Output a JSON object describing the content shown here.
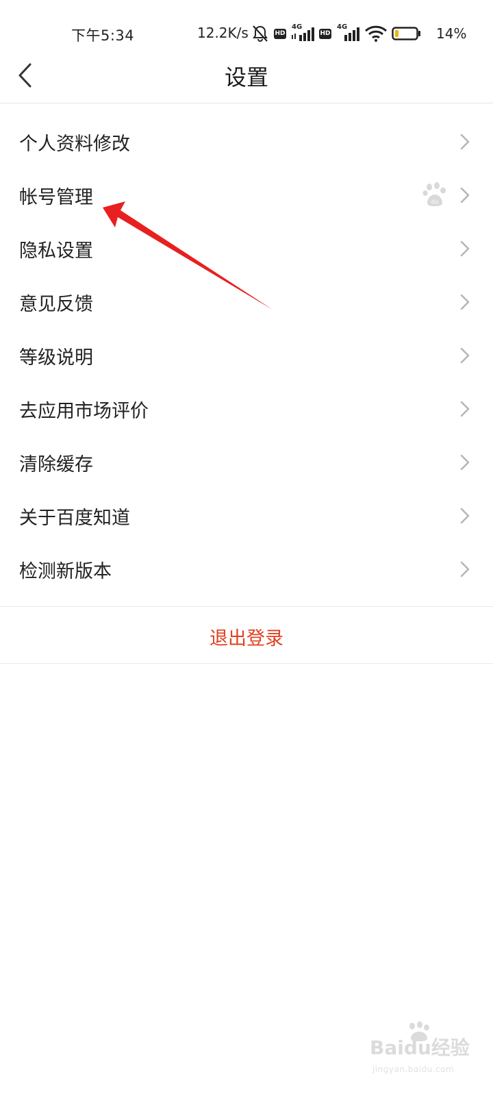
{
  "status_bar": {
    "time": "下午5:34",
    "speed": "12.2K/s",
    "hd_label": "HD",
    "net_label": "4G",
    "battery": "14%"
  },
  "header": {
    "title": "设置"
  },
  "menu": {
    "items": [
      {
        "label": "个人资料修改"
      },
      {
        "label": "帐号管理"
      },
      {
        "label": "隐私设置"
      },
      {
        "label": "意见反馈"
      },
      {
        "label": "等级说明"
      },
      {
        "label": "去应用市场评价"
      },
      {
        "label": "清除缓存"
      },
      {
        "label": "关于百度知道"
      },
      {
        "label": "检测新版本"
      }
    ]
  },
  "logout": {
    "label": "退出登录"
  },
  "watermark": {
    "text": "Baidu经验",
    "sub": "jingyan.baidu.com"
  },
  "colors": {
    "accent": "#e0401f",
    "annotation_arrow": "#e82020"
  }
}
